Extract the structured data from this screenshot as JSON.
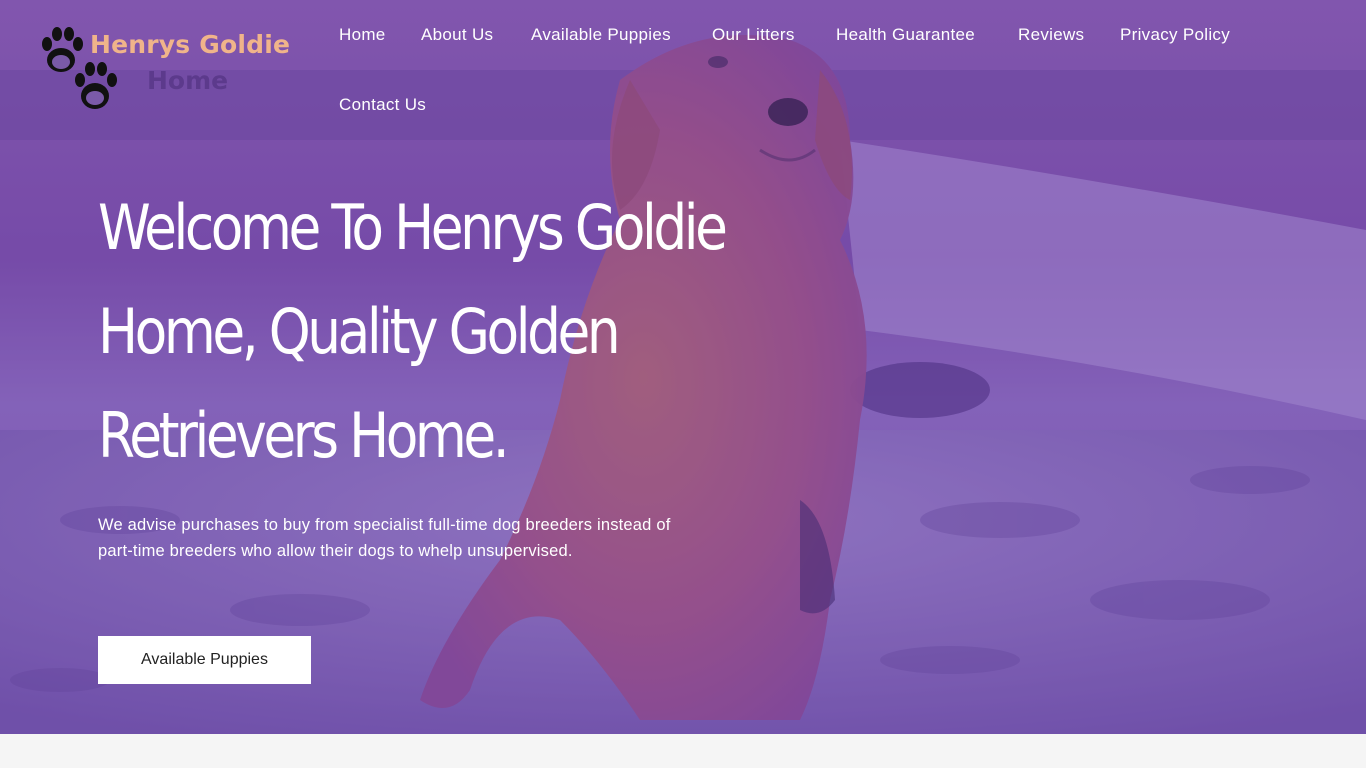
{
  "site": {
    "logo_line1": "Henrys Goldie",
    "logo_line2": "Home"
  },
  "nav": {
    "items": [
      {
        "label": "Home"
      },
      {
        "label": "About Us"
      },
      {
        "label": "Available Puppies"
      },
      {
        "label": "Our Litters"
      },
      {
        "label": "Health Guarantee"
      },
      {
        "label": "Reviews"
      },
      {
        "label": "Privacy Policy"
      },
      {
        "label": "Contact Us"
      }
    ]
  },
  "hero": {
    "headline": "Welcome To Henrys Goldie Home, Quality Golden Retrievers Home.",
    "subtext": "We advise purchases to buy from specialist full-time dog breeders instead of part-time breeders who allow their dogs to whelp unsupervised.",
    "cta_label": "Available Puppies"
  },
  "colors": {
    "overlay": "#6a3fa8",
    "logo_accent": "#f0b48a",
    "logo_secondary": "#5c3a8c",
    "below_hero": "#f5f5f5"
  },
  "icons": {
    "logo": "paw-prints-icon"
  }
}
